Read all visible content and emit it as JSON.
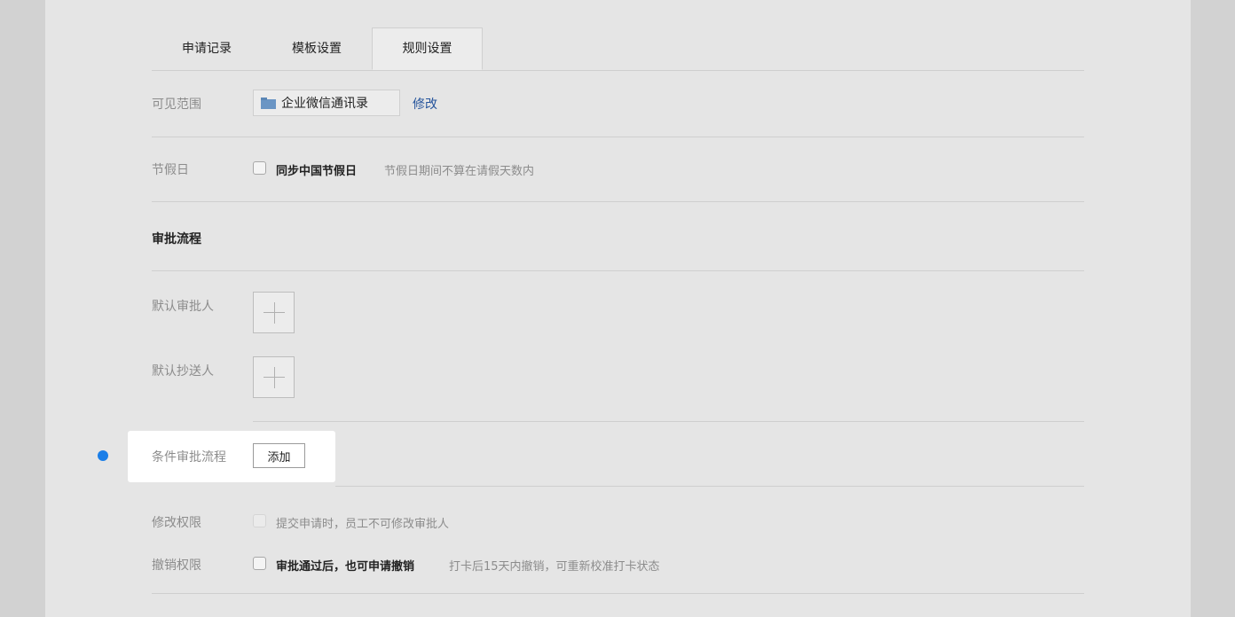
{
  "tabs": [
    {
      "label": "申请记录"
    },
    {
      "label": "模板设置"
    },
    {
      "label": "规则设置",
      "active": true
    }
  ],
  "visible_scope": {
    "label": "可见范围",
    "value": "企业微信通讯录",
    "value_icon": "folder-icon",
    "edit_link": "修改"
  },
  "holiday": {
    "label": "节假日",
    "checkbox_label": "同步中国节假日",
    "checked": false,
    "hint": "节假日期间不算在请假天数内"
  },
  "approval_flow": {
    "title": "审批流程",
    "default_approver_label": "默认审批人",
    "default_cc_label": "默认抄送人",
    "add_icon": "plus-icon"
  },
  "conditional_flow": {
    "label": "条件审批流程",
    "add_button": "添加",
    "marker_color": "#1a7ee8"
  },
  "modify_permission": {
    "label": "修改权限",
    "checkbox_label": "提交申请时，员工不可修改审批人",
    "checked": false,
    "disabled": true
  },
  "revoke_permission": {
    "label": "撤销权限",
    "checkbox_label": "审批通过后，也可申请撤销",
    "checked": false,
    "hint": "打卡后15天内撤销，可重新校准打卡状态"
  },
  "colors": {
    "link": "#24539b",
    "accent_dot": "#1a7ee8",
    "panel_bg": "#e5e5e5",
    "outer_bg": "#d2d2d2"
  }
}
